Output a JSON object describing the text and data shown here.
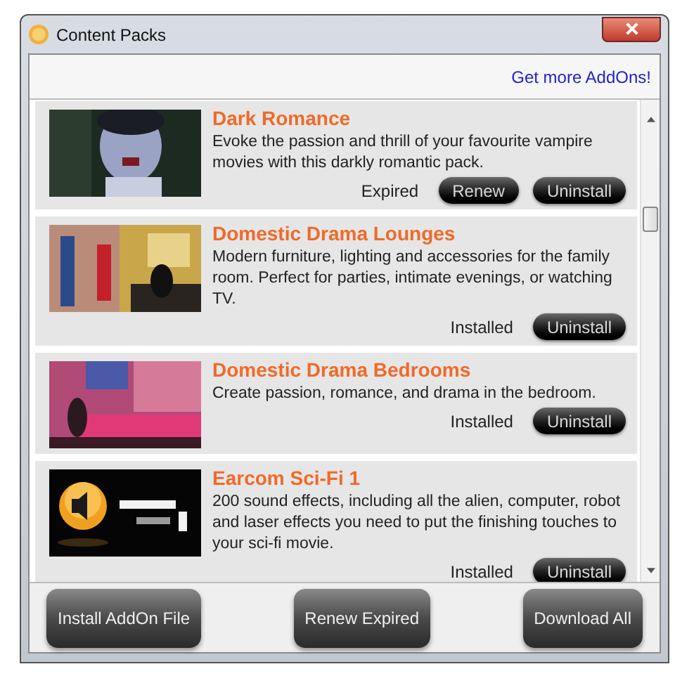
{
  "window": {
    "title": "Content Packs"
  },
  "header": {
    "link": "Get more AddOns!"
  },
  "packs": [
    {
      "title": "Dark Romance",
      "description": "Evoke the passion and thrill of your favourite vampire movies with this darkly romantic pack.",
      "status": "Expired",
      "actions": [
        "Renew",
        "Uninstall"
      ]
    },
    {
      "title": "Domestic Drama Lounges",
      "description": "Modern furniture, lighting and accessories for the family room. Perfect for parties, intimate evenings, or watching TV.",
      "status": "Installed",
      "actions": [
        "Uninstall"
      ]
    },
    {
      "title": "Domestic Drama Bedrooms",
      "description": "Create passion, romance, and drama in the bedroom.",
      "status": "Installed",
      "actions": [
        "Uninstall"
      ]
    },
    {
      "title": "Earcom Sci-Fi 1",
      "description": "200 sound effects, including all the alien, computer, robot and laser effects you need to put the finishing touches to your sci-fi movie.",
      "status": "Installed",
      "actions": [
        "Uninstall"
      ]
    }
  ],
  "buttons": [
    "Install AddOn File",
    "Renew Expired",
    "Download All"
  ]
}
